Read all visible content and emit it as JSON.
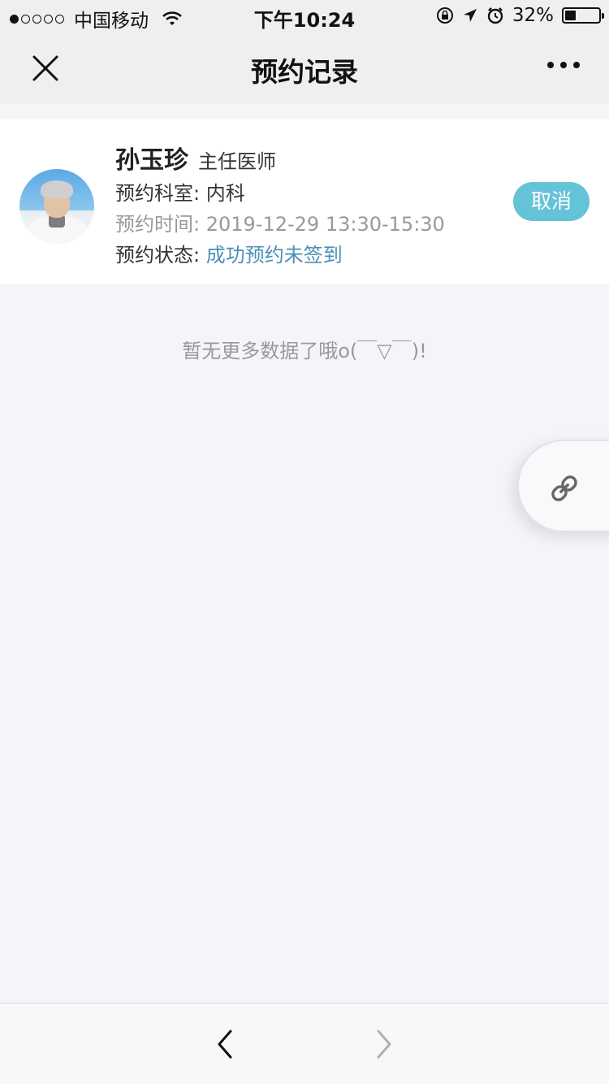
{
  "status_bar": {
    "carrier": "中国移动",
    "time": "下午10:24",
    "battery_percent": "32%",
    "battery_level": 0.32
  },
  "nav": {
    "title": "预约记录",
    "close_icon": "close-icon",
    "more_icon": "more-icon"
  },
  "appointment": {
    "doctor_name": "孙玉珍",
    "doctor_title": "主任医师",
    "dept_label": "预约科室: ",
    "dept_value": "内科",
    "time_label": "预约时间: ",
    "time_value": "2019-12-29 13:30-15:30",
    "status_label": "预约状态: ",
    "status_value": "成功预约未签到",
    "cancel_label": "取消",
    "status_color": "#4a8fb8",
    "cancel_color": "#64c3d6"
  },
  "empty_message": "暂无更多数据了哦o(￣▽￣)!",
  "float_button_icon": "link-icon",
  "toolbar": {
    "back_icon": "chevron-left-icon",
    "forward_icon": "chevron-right-icon"
  }
}
